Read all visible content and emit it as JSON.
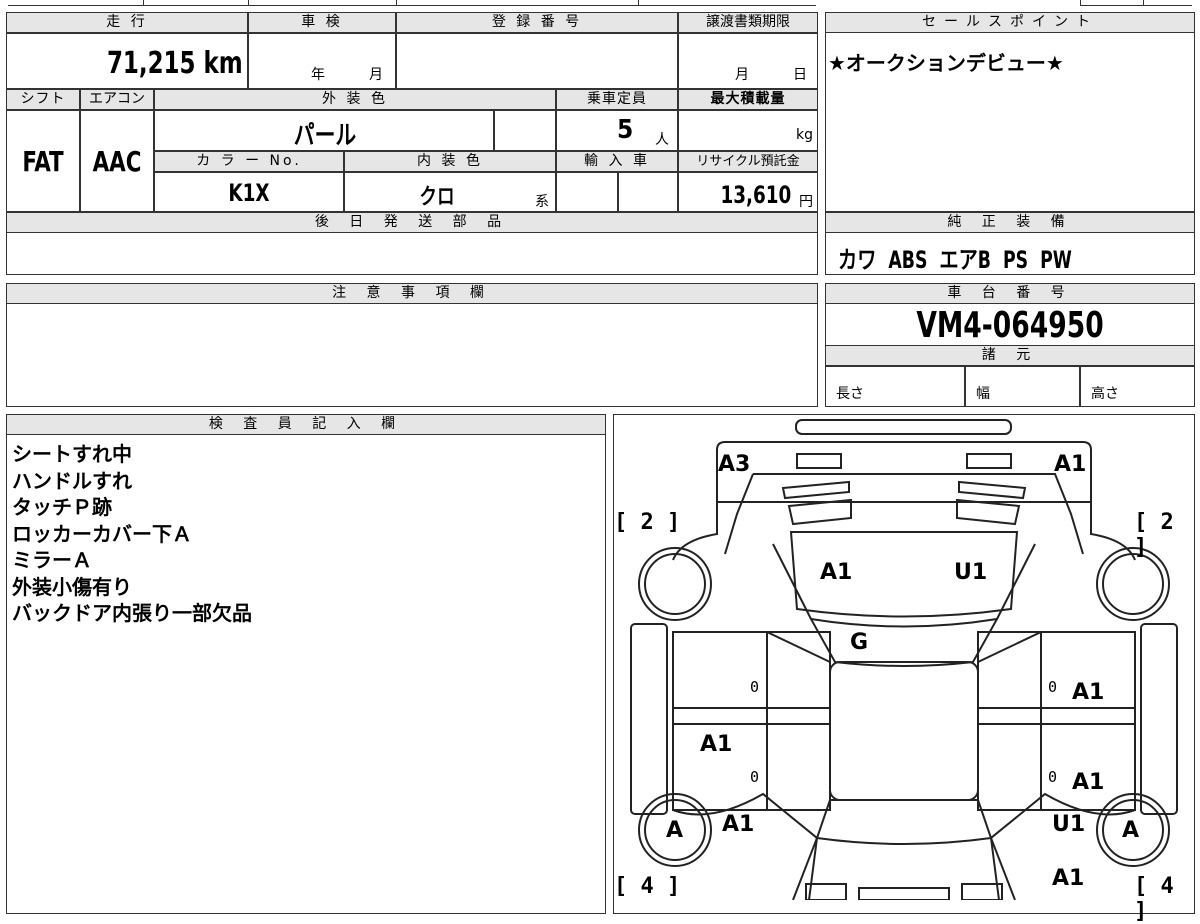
{
  "top": {
    "mileage_label": "走 行",
    "mileage_value": "71,215 km",
    "shaken_label": "車 検",
    "shaken_year": "年",
    "shaken_month": "月",
    "reg_label": "登 録 番 号",
    "reg_value": "",
    "transfer_label": "譲渡書類期限",
    "transfer_month": "月",
    "transfer_day": "日",
    "shift_label": "シフト",
    "shift_value": "FAT",
    "ac_label": "エアコン",
    "ac_value": "AAC",
    "exterior_label": "外 装 色",
    "exterior_value": "パール",
    "capacity_label": "乗車定員",
    "capacity_value": "5",
    "capacity_unit": "人",
    "maxload_label": "最大積載量",
    "maxload_unit": "kg",
    "colorno_label": "カ ラ ー No.",
    "colorno_value": "K1X",
    "interior_label": "内 装 色",
    "interior_value": "クロ",
    "interior_unit": "系",
    "import_label": "輸 入 車",
    "recycle_label": "リサイクル預託金",
    "recycle_value": "13,610",
    "recycle_unit": "円",
    "later_parts_label": "後 日 発 送 部 品"
  },
  "sales": {
    "label": "セールスポイント",
    "text": "★オークションデビュー★"
  },
  "equipment": {
    "label": "純 正 装 備",
    "text": "カワ  ABS  エアB  PS  PW"
  },
  "notes": {
    "label": "注 意 事 項 欄"
  },
  "chassis": {
    "label": "車 台 番 号",
    "value": "VM4-064950",
    "spec_label": "諸 元",
    "length": "長さ",
    "width": "幅",
    "height": "高さ"
  },
  "inspector": {
    "label": "検 査 員 記 入 欄",
    "lines": [
      "シートすれ中",
      "ハンドルすれ",
      "タッチＰ跡",
      "ロッカーカバー下Ａ",
      "ミラーＡ",
      "外装小傷有り",
      "バックドア内張り一部欠品"
    ]
  },
  "diagram": {
    "marks": {
      "a3": "A3",
      "a1_front_right": "A1",
      "hood_left": "A1",
      "hood_right": "U1",
      "windshield": "G",
      "left_door_rear": "A1",
      "right_door_front": "A1",
      "right_door_rear": "A1",
      "left_rear_fender": "A1",
      "right_rear_fender": "U1",
      "right_rear_bottom": "A1",
      "left_rear_wheel": "A",
      "right_rear_wheel": "A"
    },
    "brackets": {
      "front_left": "[ 2 ]",
      "front_right": "[ 2 ]",
      "rear_left": "[ 4 ]",
      "rear_right": "[ 4 ]"
    },
    "zeros": [
      "0",
      "0",
      "0",
      "0"
    ]
  }
}
